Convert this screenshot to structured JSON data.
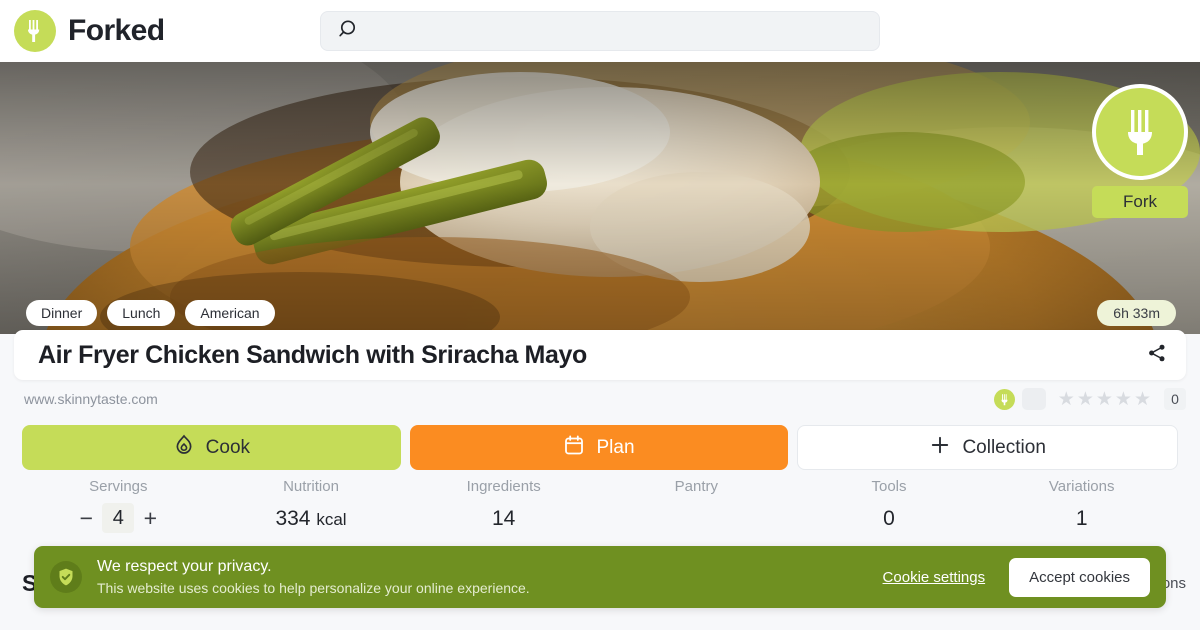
{
  "header": {
    "brand_name": "Forked",
    "logo_icon": "fork-logo-icon",
    "search_icon": "search-icon",
    "search_value": "",
    "search_placeholder": ""
  },
  "hero": {
    "image_alt": "air fryer chicken sandwich close up",
    "badge": {
      "label": "Fork",
      "icon": "fork-icon"
    },
    "tags": [
      "Dinner",
      "Lunch",
      "American"
    ],
    "total_time": "6h 33m"
  },
  "recipe": {
    "title": "Air Fryer Chicken Sandwich with Sriracha Mayo",
    "share_icon": "share-icon",
    "source_url": "www.skinnytaste.com",
    "rating": {
      "stars": 5,
      "filled": 0,
      "count": "0",
      "fork_icon": "fork-icon"
    }
  },
  "actions": [
    {
      "label": "Cook",
      "icon": "flame-icon",
      "style": "cook"
    },
    {
      "label": "Plan",
      "icon": "calendar-icon",
      "style": "plan"
    },
    {
      "label": "Collection",
      "icon": "plus-icon",
      "style": "collection"
    }
  ],
  "stats": [
    {
      "label": "Servings",
      "value": "4",
      "type": "stepper",
      "minus": "−",
      "plus": "+"
    },
    {
      "label": "Nutrition",
      "value": "334",
      "unit": "kcal",
      "type": "text"
    },
    {
      "label": "Ingredients",
      "value": "14",
      "type": "text"
    },
    {
      "label": "Pantry",
      "value": "",
      "type": "text"
    },
    {
      "label": "Tools",
      "value": "0",
      "type": "text"
    },
    {
      "label": "Variations",
      "value": "1",
      "type": "text"
    }
  ],
  "section": {
    "title": "Steps",
    "right_label": "Directions"
  },
  "cookie_banner": {
    "icon": "shield-check-icon",
    "title": "We respect your privacy.",
    "description": "This website uses cookies to help personalize your online experience.",
    "settings_label": "Cookie settings",
    "accept_label": "Accept cookies"
  },
  "colors": {
    "brand_green": "#c5dc58",
    "accent_orange": "#fb8c21",
    "banner_green": "#6f9021",
    "page_bg": "#f7f8fa"
  }
}
